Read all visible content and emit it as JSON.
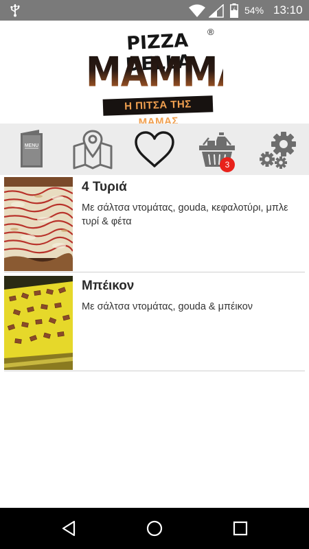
{
  "status_bar": {
    "battery_percent": "54%",
    "time": "13:10",
    "icons": [
      "usb-icon",
      "wifi-icon",
      "signal-icon",
      "battery-icon"
    ]
  },
  "logo": {
    "line1": "PIZZA DELLA",
    "registered": "®",
    "line2": "MAMMA",
    "tagline": "Η ΠΙΤΣΑ ΤΗΣ ΜΑΜΑΣ"
  },
  "toolbar": {
    "menu_icon_text": "MENU",
    "icons": [
      "menu-icon",
      "map-icon",
      "heart-icon",
      "basket-icon",
      "gears-icon"
    ],
    "cart_count": "3",
    "badge_color": "#e8221b"
  },
  "items": [
    {
      "title": "4 Τυριά",
      "description": "Με σάλτσα ντομάτας, gouda, κεφαλοτύρι, μπλε τυρί & φέτα"
    },
    {
      "title": "Μπέικον",
      "description": "Με σάλτσα ντομάτας, gouda & μπέικον"
    }
  ],
  "nav_bar": {
    "icons": [
      "back-icon",
      "home-icon",
      "recents-icon"
    ]
  },
  "colors": {
    "status_bar": "#7a7a7a",
    "toolbar_bg": "#ececec",
    "icon_gray": "#6d6d6d"
  }
}
